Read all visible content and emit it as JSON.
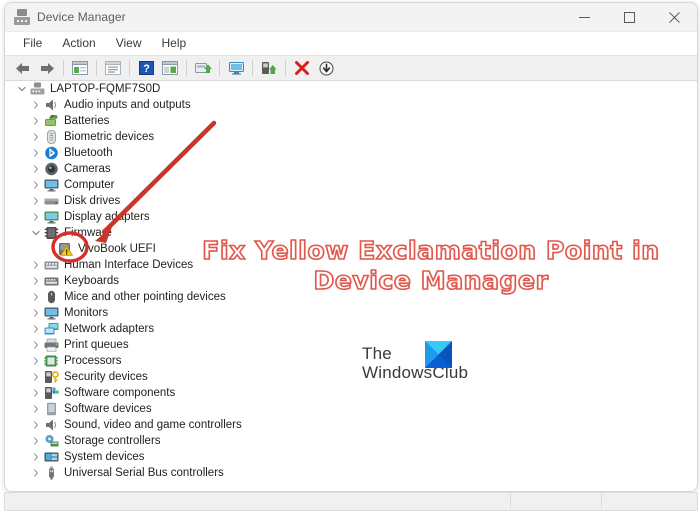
{
  "window": {
    "title": "Device Manager",
    "title_icon": "device-manager-icon",
    "controls": {
      "minimize": "minimize-icon",
      "maximize": "maximize-icon",
      "close": "close-icon"
    }
  },
  "menubar": {
    "items": [
      {
        "label": "File"
      },
      {
        "label": "Action"
      },
      {
        "label": "View"
      },
      {
        "label": "Help"
      }
    ]
  },
  "toolbar": {
    "buttons": [
      {
        "name": "back-button",
        "icon": "back-arrow-icon",
        "tooltip": "Back"
      },
      {
        "name": "forward-button",
        "icon": "forward-arrow-icon",
        "tooltip": "Forward"
      },
      {
        "name": "show-hide-console-tree-button",
        "icon": "console-tree-icon",
        "tooltip": "Show/hide console tree"
      },
      {
        "name": "properties-button",
        "icon": "properties-icon",
        "tooltip": "Properties"
      },
      {
        "name": "help-button",
        "icon": "help-question-icon",
        "tooltip": "Help"
      },
      {
        "name": "show-hide-action-pane-button",
        "icon": "action-pane-icon",
        "tooltip": "Show/hide action pane"
      },
      {
        "name": "update-driver-button",
        "icon": "update-driver-icon",
        "tooltip": "Update driver software"
      },
      {
        "name": "scan-hardware-changes-button",
        "icon": "scan-monitor-icon",
        "tooltip": "Scan for hardware changes"
      },
      {
        "name": "enable-device-button",
        "icon": "enable-device-icon",
        "tooltip": "Enable device"
      },
      {
        "name": "uninstall-device-button",
        "icon": "red-x-icon",
        "tooltip": "Uninstall device"
      },
      {
        "name": "disable-device-button",
        "icon": "down-arrow-circle-icon",
        "tooltip": "Disable device"
      }
    ]
  },
  "tree": {
    "root": {
      "label": "LAPTOP-FQMF7S0D",
      "icon": "computer-root-icon",
      "expanded": true
    },
    "nodes": [
      {
        "label": "Audio inputs and outputs",
        "icon": "speaker-icon",
        "expanded": false,
        "indent": 1
      },
      {
        "label": "Batteries",
        "icon": "battery-icon",
        "expanded": false,
        "indent": 1
      },
      {
        "label": "Biometric devices",
        "icon": "fingerprint-icon",
        "expanded": false,
        "indent": 1
      },
      {
        "label": "Bluetooth",
        "icon": "bluetooth-icon",
        "expanded": false,
        "indent": 1
      },
      {
        "label": "Cameras",
        "icon": "camera-icon",
        "expanded": false,
        "indent": 1
      },
      {
        "label": "Computer",
        "icon": "monitor-icon",
        "expanded": false,
        "indent": 1
      },
      {
        "label": "Disk drives",
        "icon": "disk-drive-icon",
        "expanded": false,
        "indent": 1
      },
      {
        "label": "Display adapters",
        "icon": "display-adapter-icon",
        "expanded": false,
        "indent": 1
      },
      {
        "label": "Firmware",
        "icon": "firmware-chip-icon",
        "expanded": true,
        "indent": 1
      },
      {
        "label": "VivoBook UEFI",
        "icon": "warning-device-icon",
        "expanded": false,
        "indent": 2,
        "has_warning": true
      },
      {
        "label": "Human Interface Devices",
        "icon": "hid-icon",
        "expanded": false,
        "indent": 1
      },
      {
        "label": "Keyboards",
        "icon": "keyboard-icon",
        "expanded": false,
        "indent": 1
      },
      {
        "label": "Mice and other pointing devices",
        "icon": "mouse-icon",
        "expanded": false,
        "indent": 1
      },
      {
        "label": "Monitors",
        "icon": "monitor-icon",
        "expanded": false,
        "indent": 1
      },
      {
        "label": "Network adapters",
        "icon": "network-adapter-icon",
        "expanded": false,
        "indent": 1
      },
      {
        "label": "Print queues",
        "icon": "printer-icon",
        "expanded": false,
        "indent": 1
      },
      {
        "label": "Processors",
        "icon": "processor-icon",
        "expanded": false,
        "indent": 1
      },
      {
        "label": "Security devices",
        "icon": "security-key-icon",
        "expanded": false,
        "indent": 1
      },
      {
        "label": "Software components",
        "icon": "software-component-icon",
        "expanded": false,
        "indent": 1
      },
      {
        "label": "Software devices",
        "icon": "software-device-icon",
        "expanded": false,
        "indent": 1
      },
      {
        "label": "Sound, video and game controllers",
        "icon": "speaker-icon",
        "expanded": false,
        "indent": 1
      },
      {
        "label": "Storage controllers",
        "icon": "storage-controller-icon",
        "expanded": false,
        "indent": 1
      },
      {
        "label": "System devices",
        "icon": "system-device-icon",
        "expanded": false,
        "indent": 1
      },
      {
        "label": "Universal Serial Bus controllers",
        "icon": "usb-icon",
        "expanded": false,
        "indent": 1
      }
    ]
  },
  "annotations": {
    "headline_line1": "Fix Yellow Exclamation Point in",
    "headline_line2": "Device Manager",
    "headline_color": "#e2574c",
    "arrow": {
      "name": "red-pointer-arrow",
      "color": "#c9342b"
    },
    "highlight_circle": {
      "name": "red-highlight-ellipse",
      "color": "#d62f26"
    }
  },
  "watermark": {
    "line1": "The",
    "line2": "WindowsClub",
    "logo_name": "windowsclub-logo",
    "logo_colors": {
      "light": "#29c5f6",
      "dark": "#0a5fd6"
    }
  }
}
